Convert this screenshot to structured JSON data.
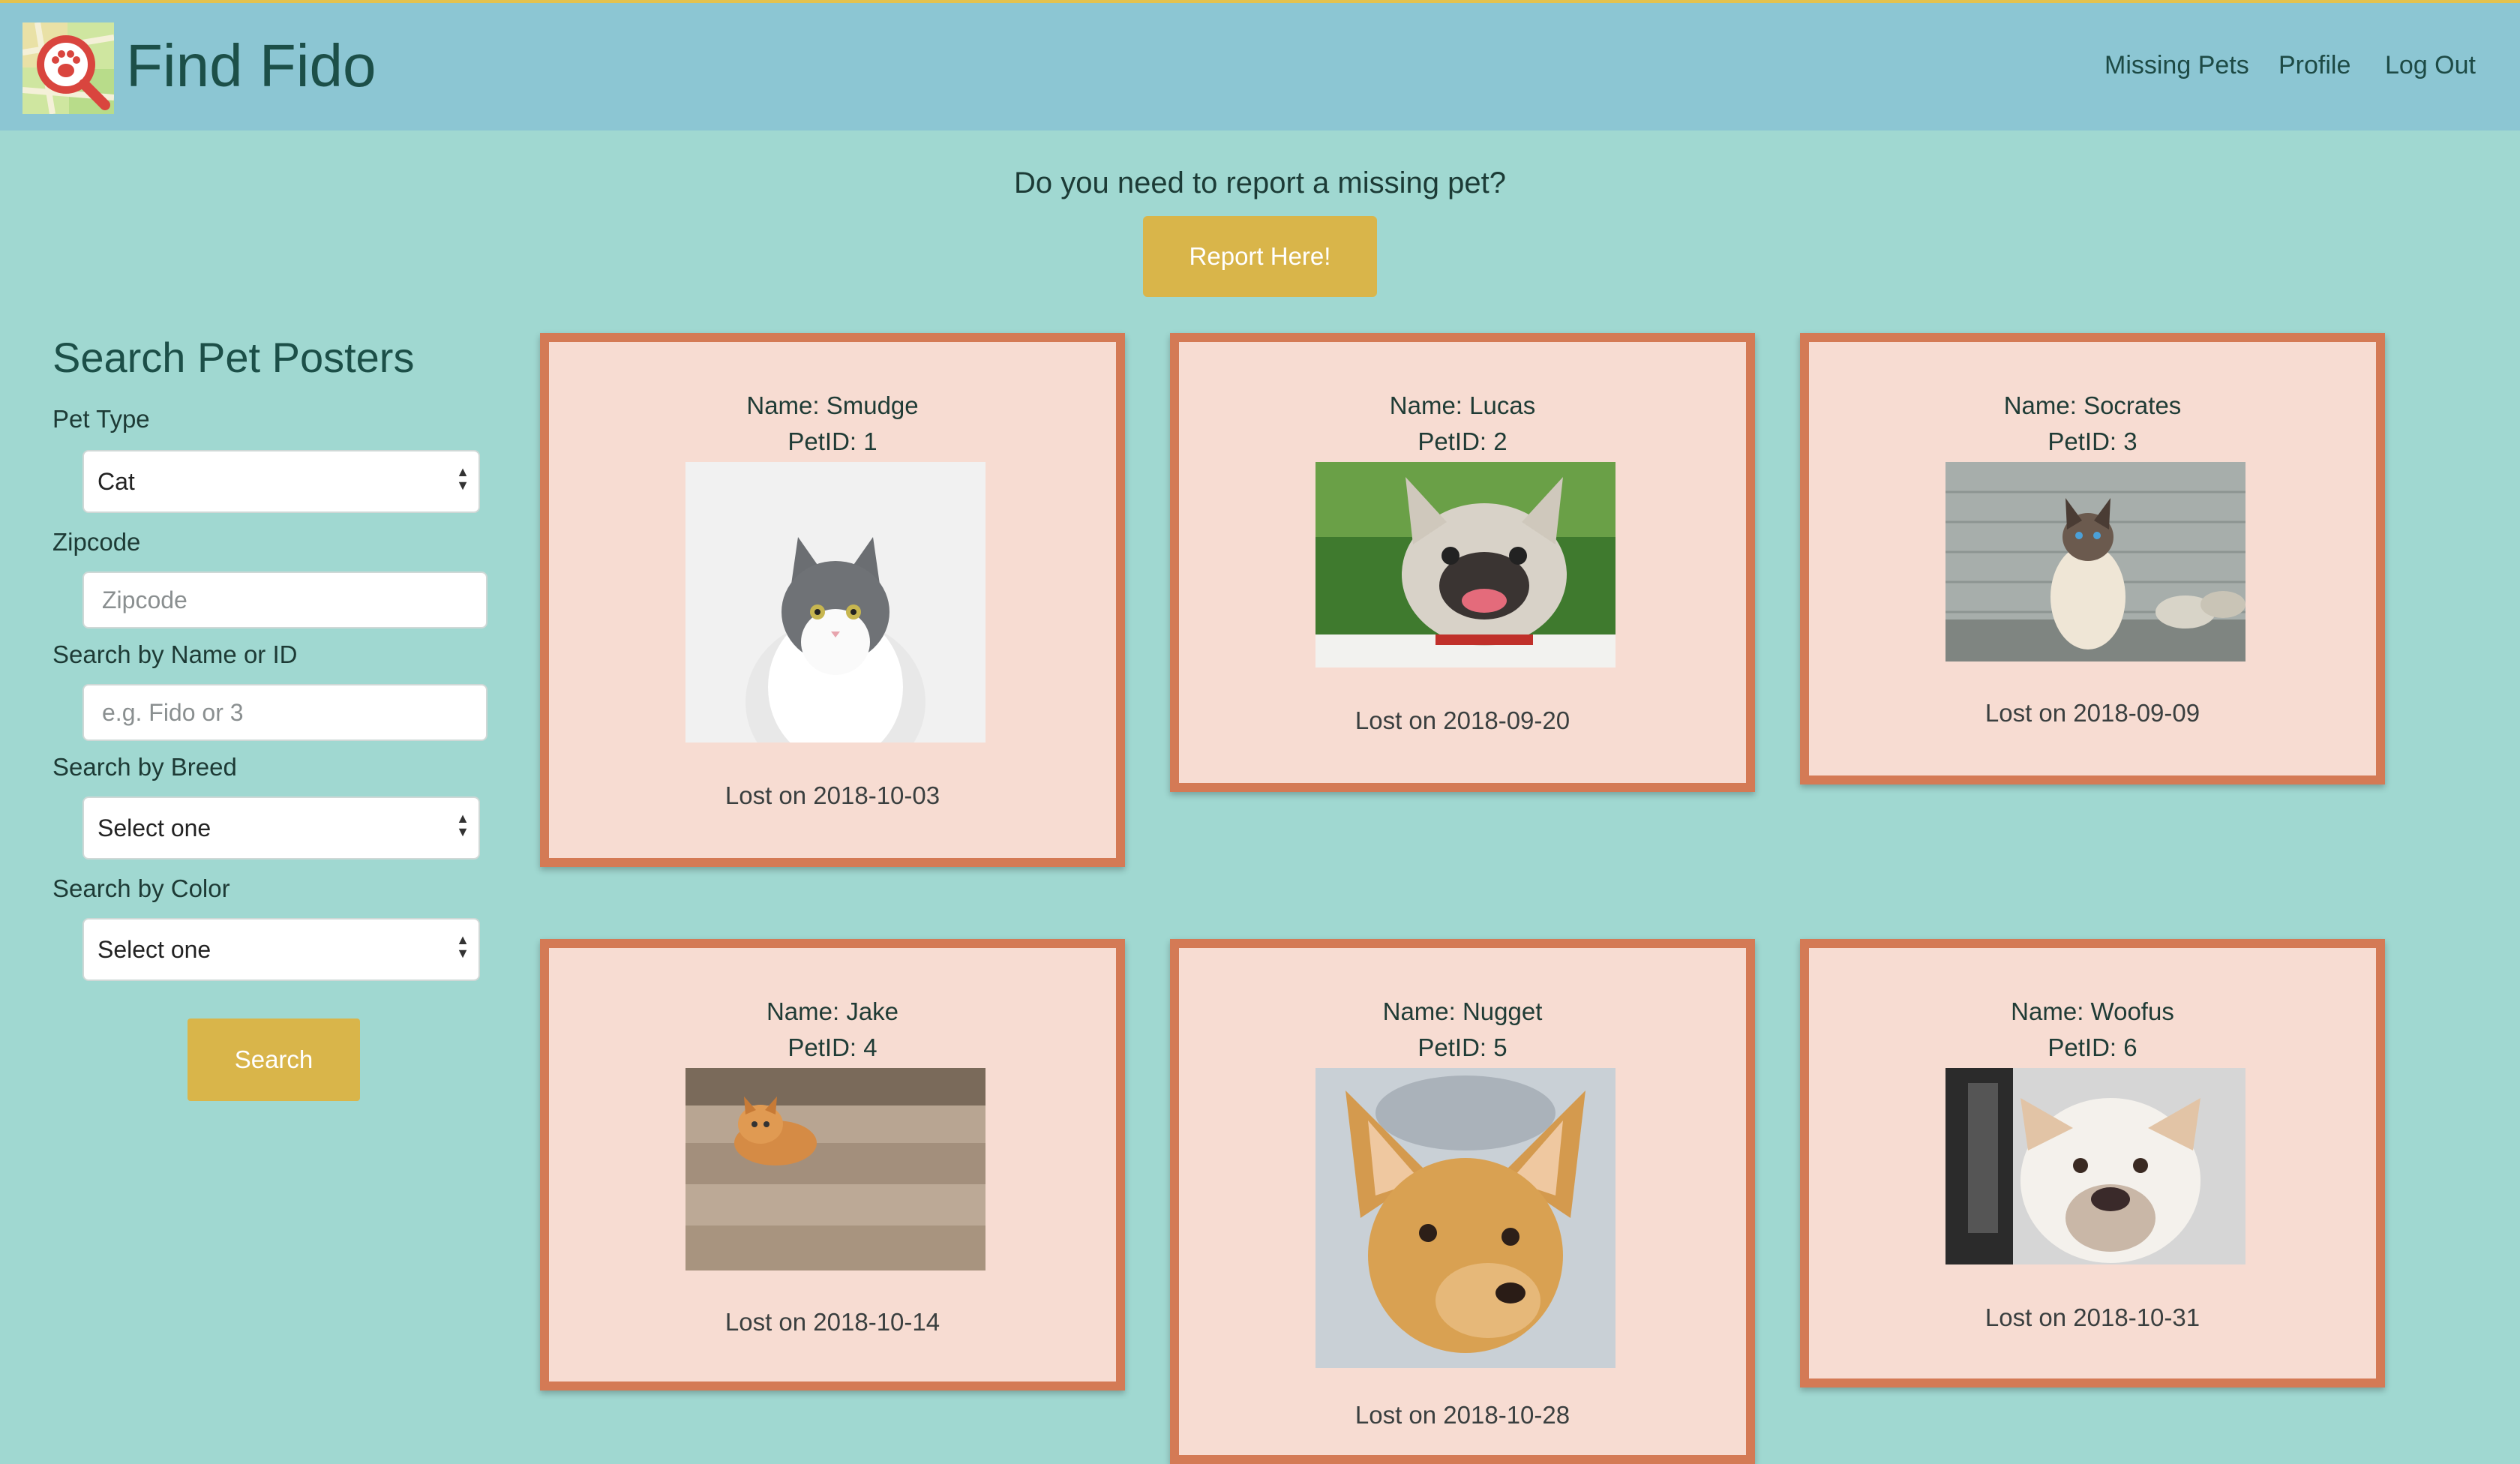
{
  "app": {
    "brand": "Find Fido",
    "nav": [
      "Missing Pets",
      "Profile",
      "Log Out"
    ]
  },
  "report": {
    "question": "Do you need to report a missing pet?",
    "button": "Report Here!"
  },
  "sidebar": {
    "title": "Search Pet Posters",
    "pet_type_label": "Pet Type",
    "pet_type_value": "Cat",
    "zipcode_label": "Zipcode",
    "zipcode_placeholder": "Zipcode",
    "name_id_label": "Search by Name or ID",
    "name_id_placeholder": "e.g. Fido or 3",
    "breed_label": "Search by Breed",
    "breed_value": "Select one",
    "color_label": "Search by Color",
    "color_value": "Select one",
    "search_button": "Search"
  },
  "pets": [
    {
      "name": "Name: Smudge",
      "pid": "PetID: 1",
      "lost": "Lost on 2018-10-03",
      "photo": "gray-white-cat"
    },
    {
      "name": "Name: Lucas",
      "pid": "PetID: 2",
      "lost": "Lost on 2018-09-20",
      "photo": "french-bulldog"
    },
    {
      "name": "Name: Socrates",
      "pid": "PetID: 3",
      "lost": "Lost on 2018-09-09",
      "photo": "siamese-cat"
    },
    {
      "name": "Name: Jake",
      "pid": "PetID: 4",
      "lost": "Lost on 2018-10-14",
      "photo": "orange-kitten-stairs"
    },
    {
      "name": "Name: Nugget",
      "pid": "PetID: 5",
      "lost": "Lost on 2018-10-28",
      "photo": "chihuahua"
    },
    {
      "name": "Name: Woofus",
      "pid": "PetID: 6",
      "lost": "Lost on 2018-10-31",
      "photo": "boxer-dog"
    }
  ],
  "colors": {
    "background": "#a0d8d1",
    "navbar": "#8cc6d3",
    "accent_button": "#d9b54a",
    "card_border": "#d47a55",
    "card_fill": "#f7dcd2"
  }
}
